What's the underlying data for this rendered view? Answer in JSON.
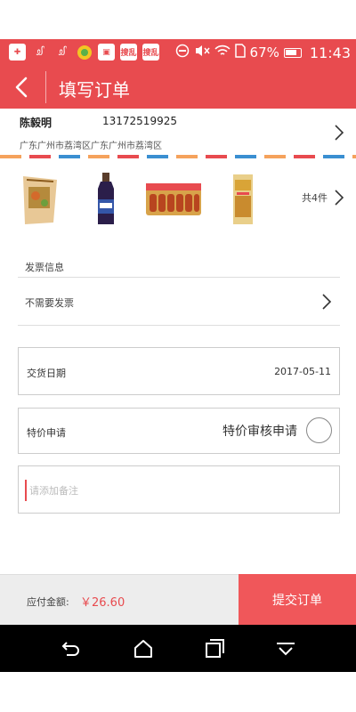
{
  "status_bar": {
    "icons": [
      "add-box-icon",
      "weibo-icon",
      "weibo-icon",
      "app-icon",
      "store-icon",
      "news-icon",
      "news-icon",
      "dnd-icon",
      "mute-icon",
      "wifi-icon",
      "sim-icon",
      "battery-icon"
    ],
    "notif_label_1": "搜乱",
    "notif_label_2": "搜乱",
    "battery": "67%",
    "time": "11:43"
  },
  "header": {
    "title": "填写订单"
  },
  "address": {
    "name": "陈毅明",
    "phone": "13172519925",
    "line": "广东广州市荔湾区广东广州市荔湾区"
  },
  "products": {
    "count_label": "共4件",
    "items": [
      "product-snack-bag",
      "product-bottle",
      "product-sausage-pack",
      "product-snack-stick"
    ]
  },
  "invoice": {
    "section_label": "发票信息",
    "value": "不需要发票"
  },
  "delivery": {
    "label": "交货日期",
    "value": "2017-05-11"
  },
  "special": {
    "label": "特价申请",
    "option": "特价审核申请"
  },
  "note": {
    "placeholder": "请添加备注"
  },
  "footer": {
    "amount_label": "应付金额:",
    "amount_value": "￥26.60",
    "submit_label": "提交订单"
  },
  "colors": {
    "accent": "#e84b4f",
    "submit": "#f0575a"
  }
}
